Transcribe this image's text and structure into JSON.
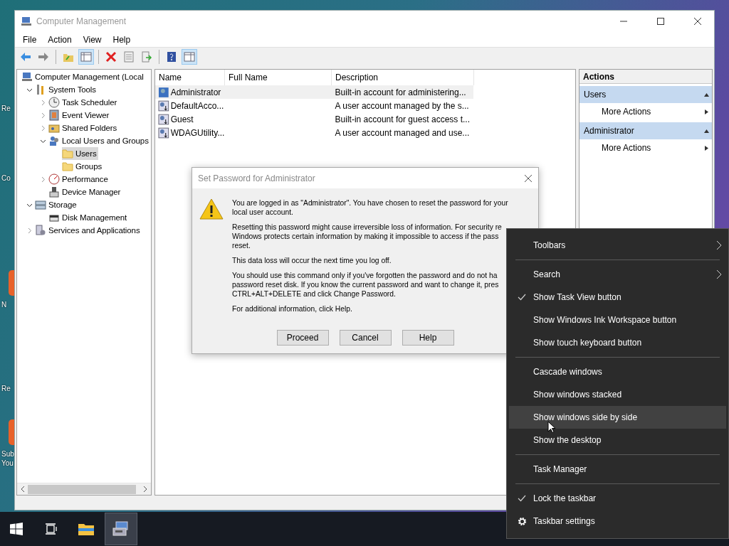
{
  "desktop": {
    "icons": [
      {
        "label_lines": [
          "Re"
        ]
      },
      {
        "label_lines": [
          "Co"
        ]
      },
      {
        "label_lines": [
          "N"
        ],
        "color": "#e8622a"
      },
      {
        "label_lines": [
          "Re"
        ]
      },
      {
        "label_lines": [
          "Sub",
          "You"
        ],
        "color": "#e8622a"
      }
    ]
  },
  "window": {
    "title": "Computer Management",
    "menu": [
      "File",
      "Action",
      "View",
      "Help"
    ],
    "toolbar": [
      {
        "kind": "back",
        "pressed": false
      },
      {
        "kind": "forward",
        "pressed": false
      },
      {
        "kind": "separator"
      },
      {
        "kind": "up",
        "pressed": false
      },
      {
        "kind": "tree",
        "pressed": true
      },
      {
        "kind": "separator"
      },
      {
        "kind": "delete",
        "pressed": false
      },
      {
        "kind": "properties",
        "pressed": false
      },
      {
        "kind": "export",
        "pressed": false
      },
      {
        "kind": "separator"
      },
      {
        "kind": "help",
        "pressed": false
      },
      {
        "kind": "actionpane",
        "pressed": true
      }
    ],
    "tree": [
      {
        "label": "Computer Management (Local",
        "kind": "computer",
        "selected": false,
        "children": [
          {
            "label": "System Tools",
            "kind": "tools",
            "expanded": true,
            "selected": false,
            "children": [
              {
                "label": "Task Scheduler",
                "kind": "clock",
                "expanded": false,
                "selected": false
              },
              {
                "label": "Event Viewer",
                "kind": "log",
                "expanded": false,
                "selected": false
              },
              {
                "label": "Shared Folders",
                "kind": "share",
                "expanded": false,
                "selected": false
              },
              {
                "label": "Local Users and Groups",
                "kind": "users",
                "expanded": true,
                "selected": false,
                "children": [
                  {
                    "label": "Users",
                    "kind": "folder",
                    "selected": true
                  },
                  {
                    "label": "Groups",
                    "kind": "folder",
                    "selected": false
                  }
                ]
              },
              {
                "label": "Performance",
                "kind": "gauge",
                "expanded": false,
                "selected": false
              },
              {
                "label": "Device Manager",
                "kind": "device",
                "selected": false
              }
            ]
          },
          {
            "label": "Storage",
            "kind": "storage",
            "expanded": true,
            "selected": false,
            "children": [
              {
                "label": "Disk Management",
                "kind": "disk",
                "selected": false
              }
            ]
          },
          {
            "label": "Services and Applications",
            "kind": "services",
            "expanded": false,
            "selected": false
          }
        ]
      }
    ],
    "list": {
      "columns": [
        "Name",
        "Full Name",
        "Description"
      ],
      "rows": [
        {
          "name": "Administrator",
          "full_name": "",
          "description": "Built-in account for administering...",
          "kind": "admin",
          "selected": true
        },
        {
          "name": "DefaultAcco...",
          "full_name": "",
          "description": "A user account managed by the s...",
          "kind": "user",
          "selected": false
        },
        {
          "name": "Guest",
          "full_name": "",
          "description": "Built-in account for guest access t...",
          "kind": "user",
          "selected": false
        },
        {
          "name": "WDAGUtility...",
          "full_name": "",
          "description": "A user account managed and use...",
          "kind": "user",
          "selected": false
        }
      ]
    },
    "actions": {
      "title": "Actions",
      "groups": [
        {
          "label": "Users",
          "items": [
            "More Actions"
          ]
        },
        {
          "label": "Administrator",
          "items": [
            "More Actions"
          ]
        }
      ]
    }
  },
  "dialog": {
    "title": "Set Password for Administrator",
    "paragraphs": [
      {
        "lines": [
          "You are logged in as \"Administrator\". You have chosen to reset the password for your",
          "local user account."
        ]
      },
      {
        "lines": [
          "Resetting this password might cause irreversible loss of information. For security re",
          "Windows protects certain information by making it impossible to access if the pass",
          "reset."
        ]
      },
      {
        "lines": [
          "This data loss will occur the next time you log off."
        ]
      },
      {
        "lines": [
          "You should use this command only if you've forgotten the password and do not ha",
          "password reset disk. If you know the current password and want to change it, pres",
          "CTRL+ALT+DELETE and click Change Password."
        ]
      },
      {
        "lines": [
          "For additional information, click Help."
        ]
      }
    ],
    "buttons": [
      "Proceed",
      "Cancel",
      "Help"
    ]
  },
  "context_menu": [
    {
      "kind": "item",
      "label": "Toolbars",
      "submenu": true,
      "checked": false,
      "highlighted": false
    },
    {
      "kind": "separator"
    },
    {
      "kind": "item",
      "label": "Search",
      "submenu": true,
      "checked": false,
      "highlighted": false
    },
    {
      "kind": "item",
      "label": "Show Task View button",
      "submenu": false,
      "checked": true,
      "highlighted": false
    },
    {
      "kind": "item",
      "label": "Show Windows Ink Workspace button",
      "submenu": false,
      "checked": false,
      "highlighted": false
    },
    {
      "kind": "item",
      "label": "Show touch keyboard button",
      "submenu": false,
      "checked": false,
      "highlighted": false
    },
    {
      "kind": "separator"
    },
    {
      "kind": "item",
      "label": "Cascade windows",
      "submenu": false,
      "checked": false,
      "highlighted": false
    },
    {
      "kind": "item",
      "label": "Show windows stacked",
      "submenu": false,
      "checked": false,
      "highlighted": false
    },
    {
      "kind": "item",
      "label": "Show windows side by side",
      "submenu": false,
      "checked": false,
      "highlighted": true
    },
    {
      "kind": "item",
      "label": "Show the desktop",
      "submenu": false,
      "checked": false,
      "highlighted": false
    },
    {
      "kind": "separator"
    },
    {
      "kind": "item",
      "label": "Task Manager",
      "submenu": false,
      "checked": false,
      "highlighted": false
    },
    {
      "kind": "separator"
    },
    {
      "kind": "item",
      "label": "Lock the taskbar",
      "submenu": false,
      "checked": true,
      "highlighted": false
    },
    {
      "kind": "settings",
      "label": "Taskbar settings",
      "submenu": false,
      "checked": false,
      "highlighted": false
    }
  ],
  "taskbar": [
    {
      "kind": "start",
      "active": false
    },
    {
      "kind": "taskview",
      "active": false
    },
    {
      "kind": "explorer",
      "active": false
    },
    {
      "kind": "compmgmt",
      "active": true
    }
  ]
}
